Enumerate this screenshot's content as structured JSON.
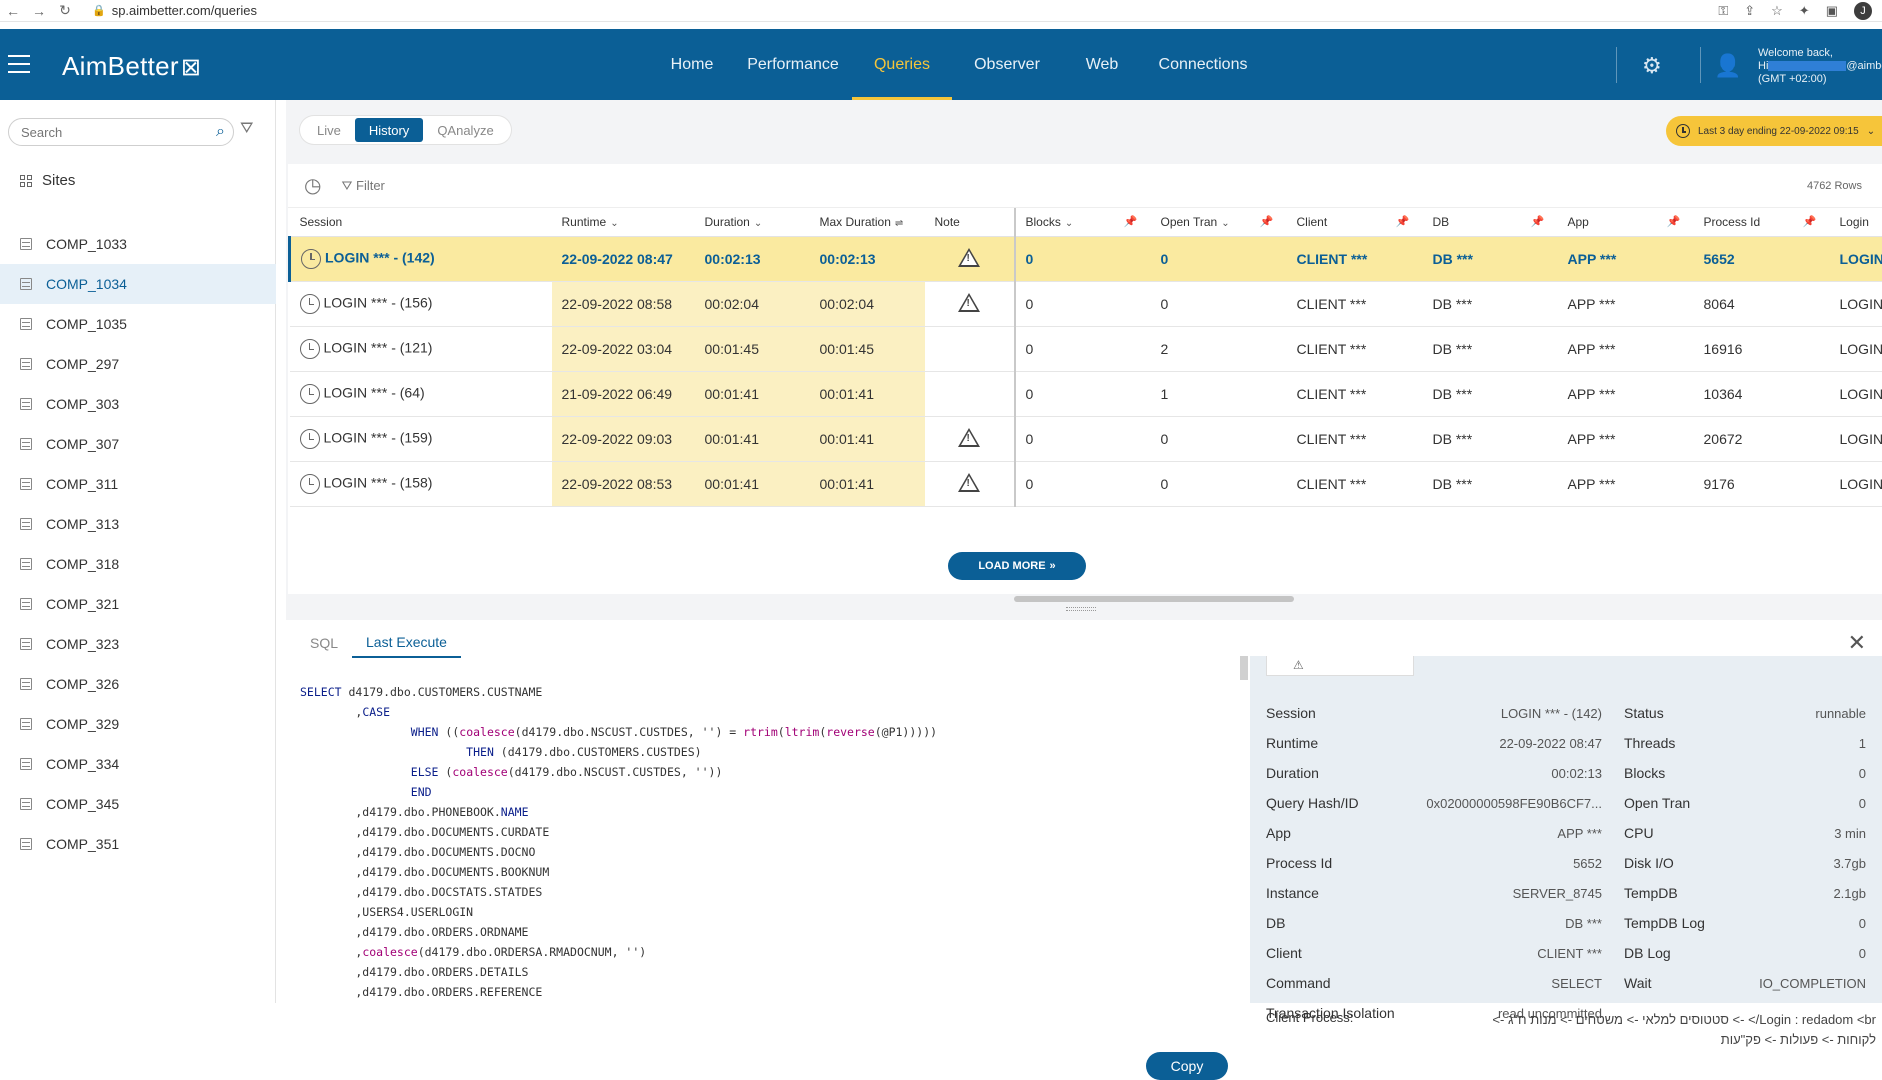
{
  "browser": {
    "url": "sp.aimbetter.com/queries",
    "profile_initial": "J"
  },
  "header": {
    "logo": "AimBetter",
    "nav": [
      "Home",
      "Performance",
      "Queries",
      "Observer",
      "Web",
      "Connections"
    ],
    "active_nav": "Queries",
    "welcome_line1": "Welcome back,",
    "welcome_hi": "Hi",
    "welcome_email_suffix": "@aimbet",
    "welcome_tz": "(GMT +02:00)"
  },
  "sidebar": {
    "search_placeholder": "Search",
    "sites_label": "Sites",
    "items": [
      "COMP_1033",
      "COMP_1034",
      "COMP_1035",
      "COMP_297",
      "COMP_303",
      "COMP_307",
      "COMP_311",
      "COMP_313",
      "COMP_318",
      "COMP_321",
      "COMP_323",
      "COMP_326",
      "COMP_329",
      "COMP_334",
      "COMP_345",
      "COMP_351"
    ],
    "active_item": "COMP_1034"
  },
  "main": {
    "tabs": [
      "Live",
      "History",
      "QAnalyze"
    ],
    "active_tab": "History",
    "time_range": "Last 3 day ending  22-09-2022 09:15",
    "filter_label": "Filter",
    "rows_count": "4762 Rows",
    "columns": [
      "Session",
      "Runtime",
      "Duration",
      "Max Duration",
      "Note",
      "Blocks",
      "Open Tran",
      "Client",
      "DB",
      "App",
      "Process Id",
      "Login"
    ],
    "rows": [
      {
        "session": "LOGIN *** - (142)",
        "runtime": "22-09-2022 08:47",
        "duration": "00:02:13",
        "max_duration": "00:02:13",
        "note": "warning",
        "blocks": "0",
        "open_tran": "0",
        "client": "CLIENT ***",
        "db": "DB ***",
        "app": "APP ***",
        "pid": "5652",
        "login": "LOGIN"
      },
      {
        "session": "LOGIN *** - (156)",
        "runtime": "22-09-2022 08:58",
        "duration": "00:02:04",
        "max_duration": "00:02:04",
        "note": "warning",
        "blocks": "0",
        "open_tran": "0",
        "client": "CLIENT ***",
        "db": "DB ***",
        "app": "APP ***",
        "pid": "8064",
        "login": "LOGIN"
      },
      {
        "session": "LOGIN *** - (121)",
        "runtime": "22-09-2022 03:04",
        "duration": "00:01:45",
        "max_duration": "00:01:45",
        "note": "",
        "blocks": "0",
        "open_tran": "2",
        "client": "CLIENT ***",
        "db": "DB ***",
        "app": "APP ***",
        "pid": "16916",
        "login": "LOGIN"
      },
      {
        "session": "LOGIN *** - (64)",
        "runtime": "21-09-2022 06:49",
        "duration": "00:01:41",
        "max_duration": "00:01:41",
        "note": "",
        "blocks": "0",
        "open_tran": "1",
        "client": "CLIENT ***",
        "db": "DB ***",
        "app": "APP ***",
        "pid": "10364",
        "login": "LOGIN"
      },
      {
        "session": "LOGIN *** - (159)",
        "runtime": "22-09-2022 09:03",
        "duration": "00:01:41",
        "max_duration": "00:01:41",
        "note": "warning",
        "blocks": "0",
        "open_tran": "0",
        "client": "CLIENT ***",
        "db": "DB ***",
        "app": "APP ***",
        "pid": "20672",
        "login": "LOGIN"
      },
      {
        "session": "LOGIN *** - (158)",
        "runtime": "22-09-2022 08:53",
        "duration": "00:01:41",
        "max_duration": "00:01:41",
        "note": "warning",
        "blocks": "0",
        "open_tran": "0",
        "client": "CLIENT ***",
        "db": "DB ***",
        "app": "APP ***",
        "pid": "9176",
        "login": "LOGIN"
      }
    ],
    "load_more": "LOAD MORE"
  },
  "bottom": {
    "tabs": [
      "SQL",
      "Last Execute"
    ],
    "active_tab": "Last Execute",
    "copy_label": "Copy",
    "details_left": [
      {
        "k": "Session",
        "v": "LOGIN *** - (142)"
      },
      {
        "k": "Runtime",
        "v": "22-09-2022 08:47"
      },
      {
        "k": "Duration",
        "v": "00:02:13"
      },
      {
        "k": "Query Hash/ID",
        "v": "0x02000000598FE90B6CF7..."
      },
      {
        "k": "App",
        "v": "APP ***"
      },
      {
        "k": "Process Id",
        "v": "5652"
      },
      {
        "k": "Instance",
        "v": "SERVER_8745"
      },
      {
        "k": "DB",
        "v": "DB ***"
      },
      {
        "k": "Client",
        "v": "CLIENT ***"
      },
      {
        "k": "Command",
        "v": "SELECT"
      },
      {
        "k": "Transaction Isolation",
        "v": "read uncommitted"
      }
    ],
    "details_right": [
      {
        "k": "Status",
        "v": "runnable"
      },
      {
        "k": "Threads",
        "v": "1"
      },
      {
        "k": "Blocks",
        "v": "0"
      },
      {
        "k": "Open Tran",
        "v": "0"
      },
      {
        "k": "CPU",
        "v": "3 min"
      },
      {
        "k": "Disk I/O",
        "v": "3.7gb"
      },
      {
        "k": "TempDB",
        "v": "2.1gb"
      },
      {
        "k": "TempDB Log",
        "v": "0"
      },
      {
        "k": "DB Log",
        "v": "0"
      },
      {
        "k": "Wait",
        "v": "IO_COMPLETION"
      }
    ],
    "client_process_label": "Client Process:",
    "client_process_value": "Login : redadom <br/> -> סטטוסים למלאי -> משטחים -> מנות ח\"ג -> לקוחות -> פעולות -> פק\"עות"
  }
}
